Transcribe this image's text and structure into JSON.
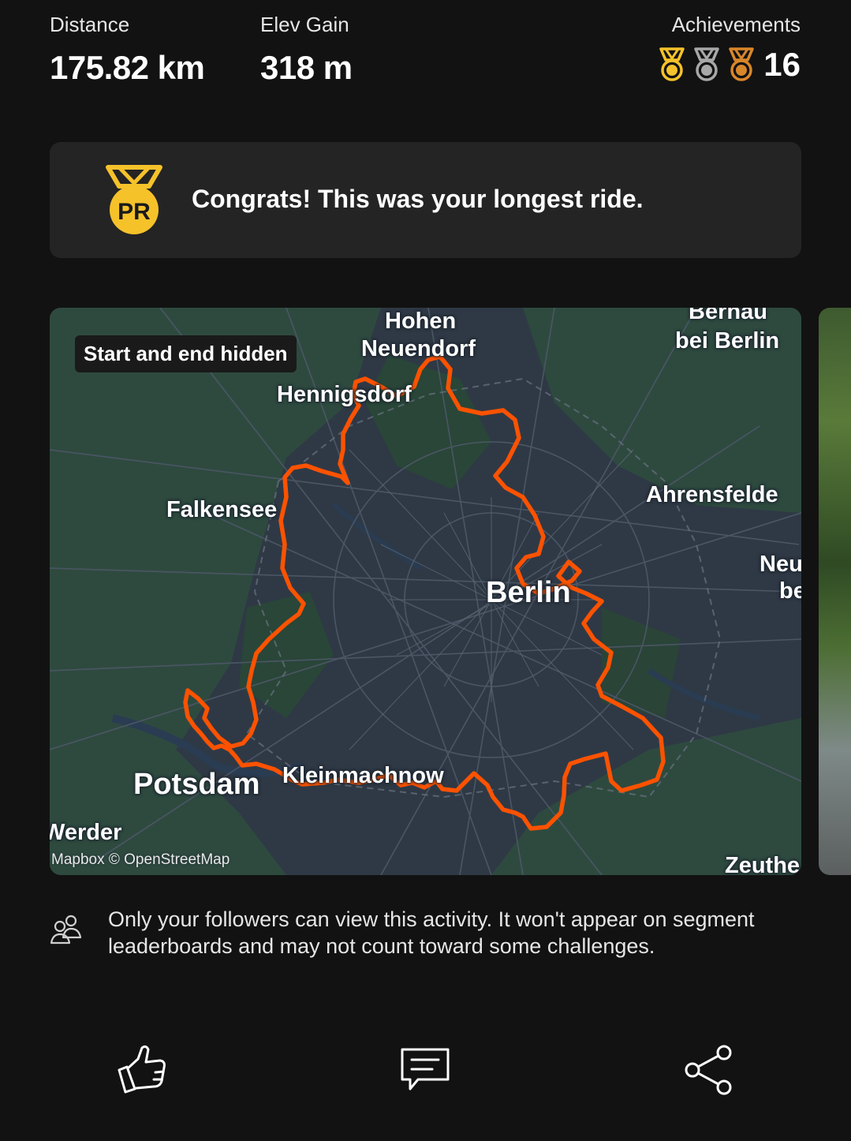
{
  "stats": {
    "distance": {
      "label": "Distance",
      "value": "175.82 km"
    },
    "elev_gain": {
      "label": "Elev Gain",
      "value": "318 m"
    },
    "achievements": {
      "label": "Achievements",
      "count": "16",
      "medals": [
        "gold-medal-icon",
        "silver-medal-icon",
        "bronze-medal-icon"
      ]
    }
  },
  "pr_banner": {
    "badge": "PR",
    "text": "Congrats! This was your longest ride."
  },
  "map": {
    "privacy_badge": "Start and end hidden",
    "attribution": "Mapbox © OpenStreetMap",
    "route_color": "#fc5200",
    "places": [
      {
        "name": "Hohen",
        "id": "hohen"
      },
      {
        "name": "Neuendorf",
        "id": "neuendorf"
      },
      {
        "name": "Bernau",
        "id": "bernau"
      },
      {
        "name": "bei Berlin",
        "id": "bei-berlin"
      },
      {
        "name": "Hennigsdorf",
        "id": "hennigsdorf"
      },
      {
        "name": "Falkensee",
        "id": "falkensee"
      },
      {
        "name": "Ahrensfelde",
        "id": "ahrensfelde"
      },
      {
        "name": "Berlin",
        "id": "berlin"
      },
      {
        "name": "Neu",
        "id": "neu"
      },
      {
        "name": "be",
        "id": "be"
      },
      {
        "name": "Potsdam",
        "id": "potsdam"
      },
      {
        "name": "Kleinmachnow",
        "id": "kleinmachnow"
      },
      {
        "name": "Werder",
        "id": "werder"
      },
      {
        "name": "Zeuthe",
        "id": "zeuthe"
      }
    ]
  },
  "privacy_note": "Only your followers can view this activity. It won't appear on segment leaderboards and may not count toward some challenges.",
  "actions": {
    "like": "thumbs-up-icon",
    "comment": "comment-icon",
    "share": "share-icon"
  },
  "colors": {
    "background": "#121212",
    "card": "#242424",
    "gold": "#f5c22a",
    "silver": "#a8a8a8",
    "bronze": "#d9862a",
    "route": "#fc5200"
  }
}
